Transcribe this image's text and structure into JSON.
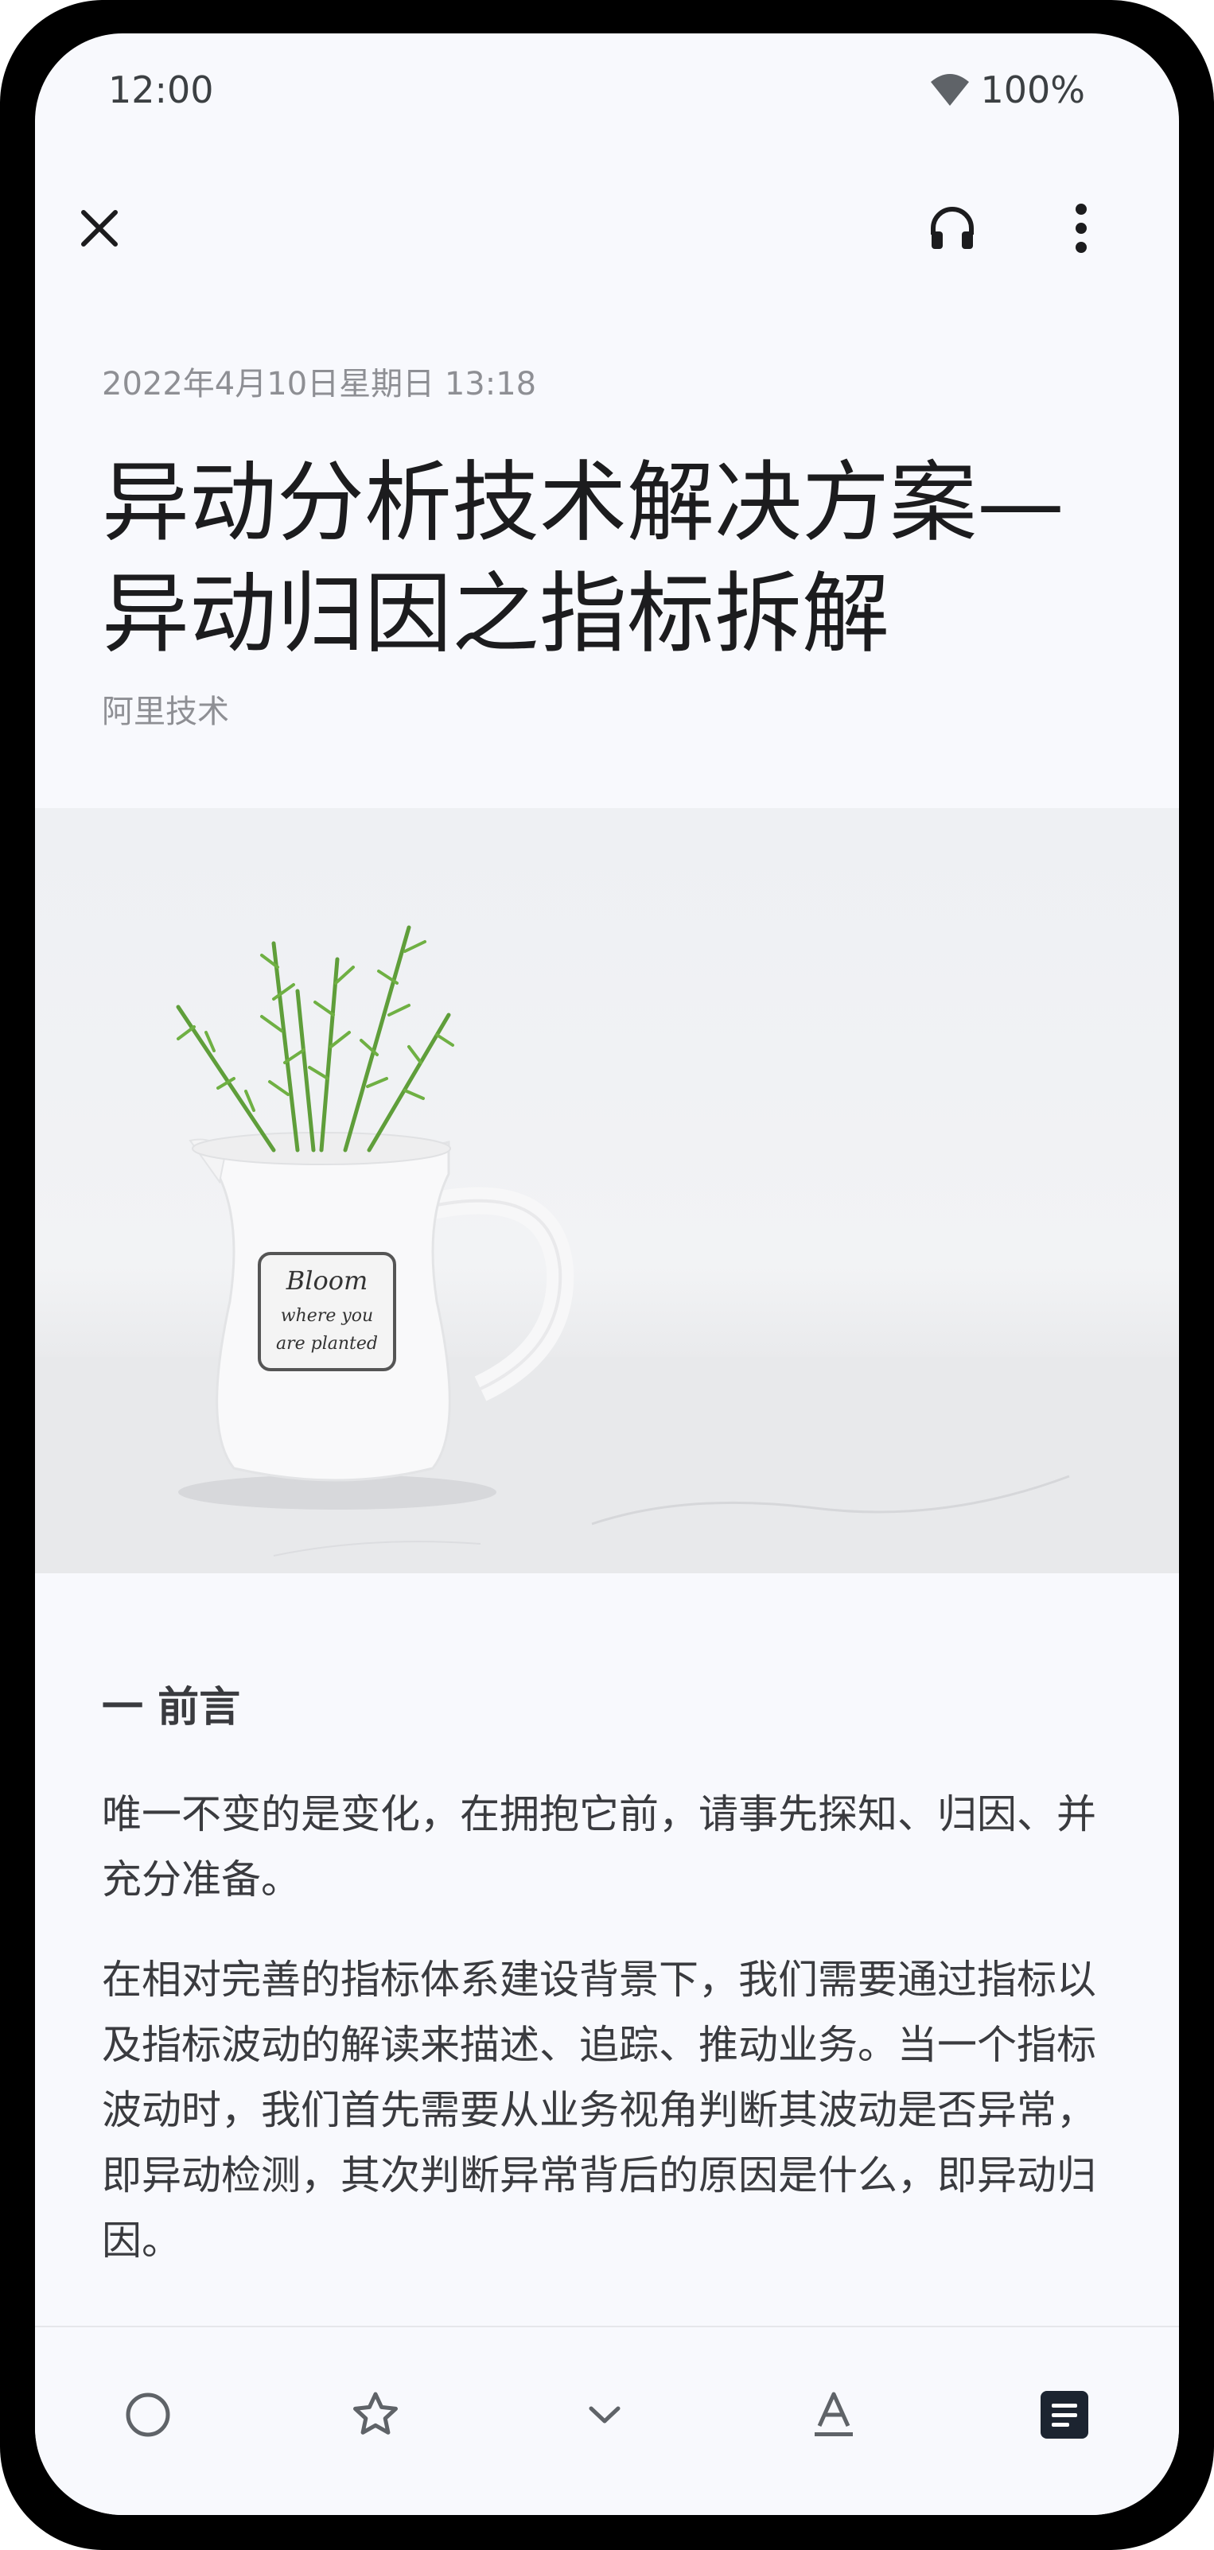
{
  "status_bar": {
    "time": "12:00",
    "battery": "100%",
    "icons": [
      "wifi-icon"
    ]
  },
  "toolbar": {
    "icons": [
      "close-icon",
      "headphones-icon",
      "more-vert-icon"
    ]
  },
  "article": {
    "date": "2022年4月10日星期日 13:18",
    "title_line1": "异动分析技术解决方案—",
    "title_line2": "异动归因之指标拆解",
    "author": "阿里技术",
    "hero_image": {
      "badge_line1": "Bloom",
      "badge_line2": "where you",
      "badge_line3": "are planted"
    },
    "section_heading": "一 前言",
    "paragraph1": "唯一不变的是变化，在拥抱它前，请事先探知、归因、并充分准备。",
    "paragraph2": "在相对完善的指标体系建设背景下，我们需要通过指标以及指标波动的解读来描述、追踪、推动业务。当一个指标波动时，我们首先需要从业务视角判断其波动是否异常，即异动检测，其次判断异常背后的原因是什么，即异动归因。"
  },
  "bottom_bar": {
    "icons": [
      "circle-icon",
      "star-icon",
      "chevron-down-icon",
      "text-format-icon",
      "article-icon"
    ]
  },
  "colors": {
    "background": "#f8f9fd",
    "text_primary": "#1c1c1e",
    "text_secondary": "#8e8f94",
    "body_text": "#3a3b3f"
  }
}
